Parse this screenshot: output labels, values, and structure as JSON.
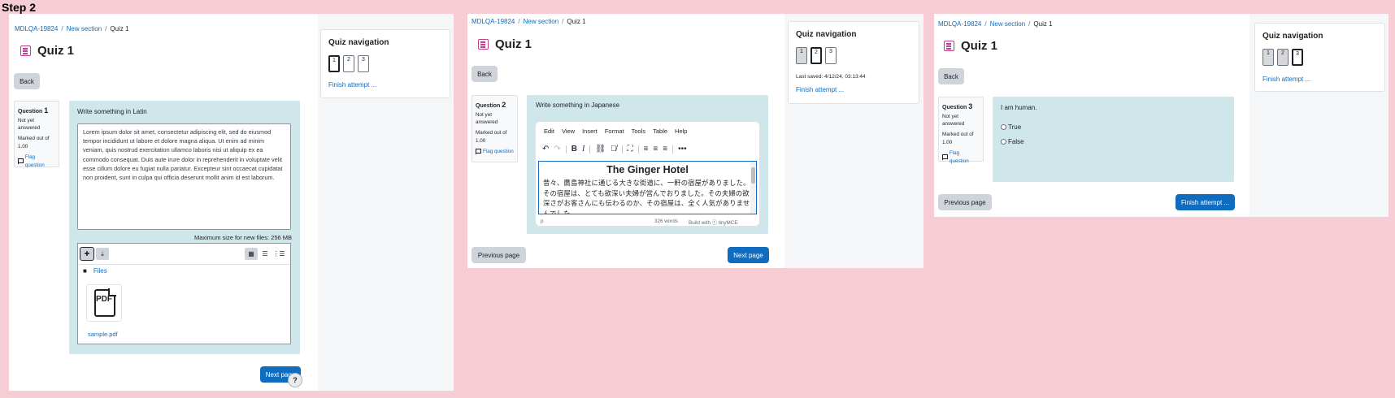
{
  "step_title": "Step 2",
  "breadcrumb": {
    "course": "MDLQA-19824",
    "section": "New section",
    "current": "Quiz 1"
  },
  "quiz_title": "Quiz 1",
  "icons": {
    "quiz": "quiz-icon",
    "flag": "flag-icon",
    "help": "question-mark-icon",
    "pdf": "pdf-file-icon",
    "folder": "folder-icon"
  },
  "colors": {
    "primary": "#0f6cbf",
    "question_bg": "#cfe6ea",
    "quiz_icon": "#c33c8e",
    "background": "#f6cdd4"
  },
  "common": {
    "back_label": "Back",
    "nav_title": "Quiz navigation",
    "finish_link": "Finish attempt ...",
    "not_yet_answered": "Not yet answered",
    "marked_out_of": "Marked out of",
    "marks": "1.00",
    "flag_question": "Flag question",
    "question_label": "Question",
    "previous_page": "Previous page",
    "next_page": "Next page",
    "help": "?"
  },
  "nav_buttons": [
    "1",
    "2",
    "3"
  ],
  "q1": {
    "number": "1",
    "prompt": "Write something in Latin",
    "answer_text": "Lorem ipsum dolor sit amet, consectetur adipiscing elit, sed do eiusmod tempor incididunt ut labore et dolore magna aliqua. Ut enim ad minim veniam, quis nostrud exercitation ullamco laboris nisi ut aliquip ex ea commodo consequat. Duis aute irure dolor in reprehenderit in voluptate velit esse cillum dolore eu fugiat nulla pariatur. Excepteur sint occaecat cupidatat non proident, sunt in culpa qui officia deserunt mollit anim id est laborum.",
    "max_size": "Maximum size for new files: 256 MB",
    "files_label": "Files",
    "file_name": "sample.pdf",
    "pdf_label": "PDF"
  },
  "q2": {
    "number": "2",
    "prompt": "Write something in Japanese",
    "menu": [
      "Edit",
      "View",
      "Insert",
      "Format",
      "Tools",
      "Table",
      "Help"
    ],
    "heading": "The Ginger Hotel",
    "body_text": "昔々、鷹島神社に通じる大きな街道に、一軒の宿屋がありました。その宿屋は、とても欲深い夫婦が営んでおりました。その夫婦の欲深さがお客さんにも伝わるのか、その宿屋は、全く人気がありませんでした。",
    "status_path": "p",
    "word_count": "326 words",
    "branding": "Build with ⓣ tinyMCE",
    "last_saved": "Last saved: 4/12/24, 03:13:44"
  },
  "q3": {
    "number": "3",
    "prompt": "I am human.",
    "options": [
      "True",
      "False"
    ],
    "finish_button": "Finish attempt ..."
  }
}
